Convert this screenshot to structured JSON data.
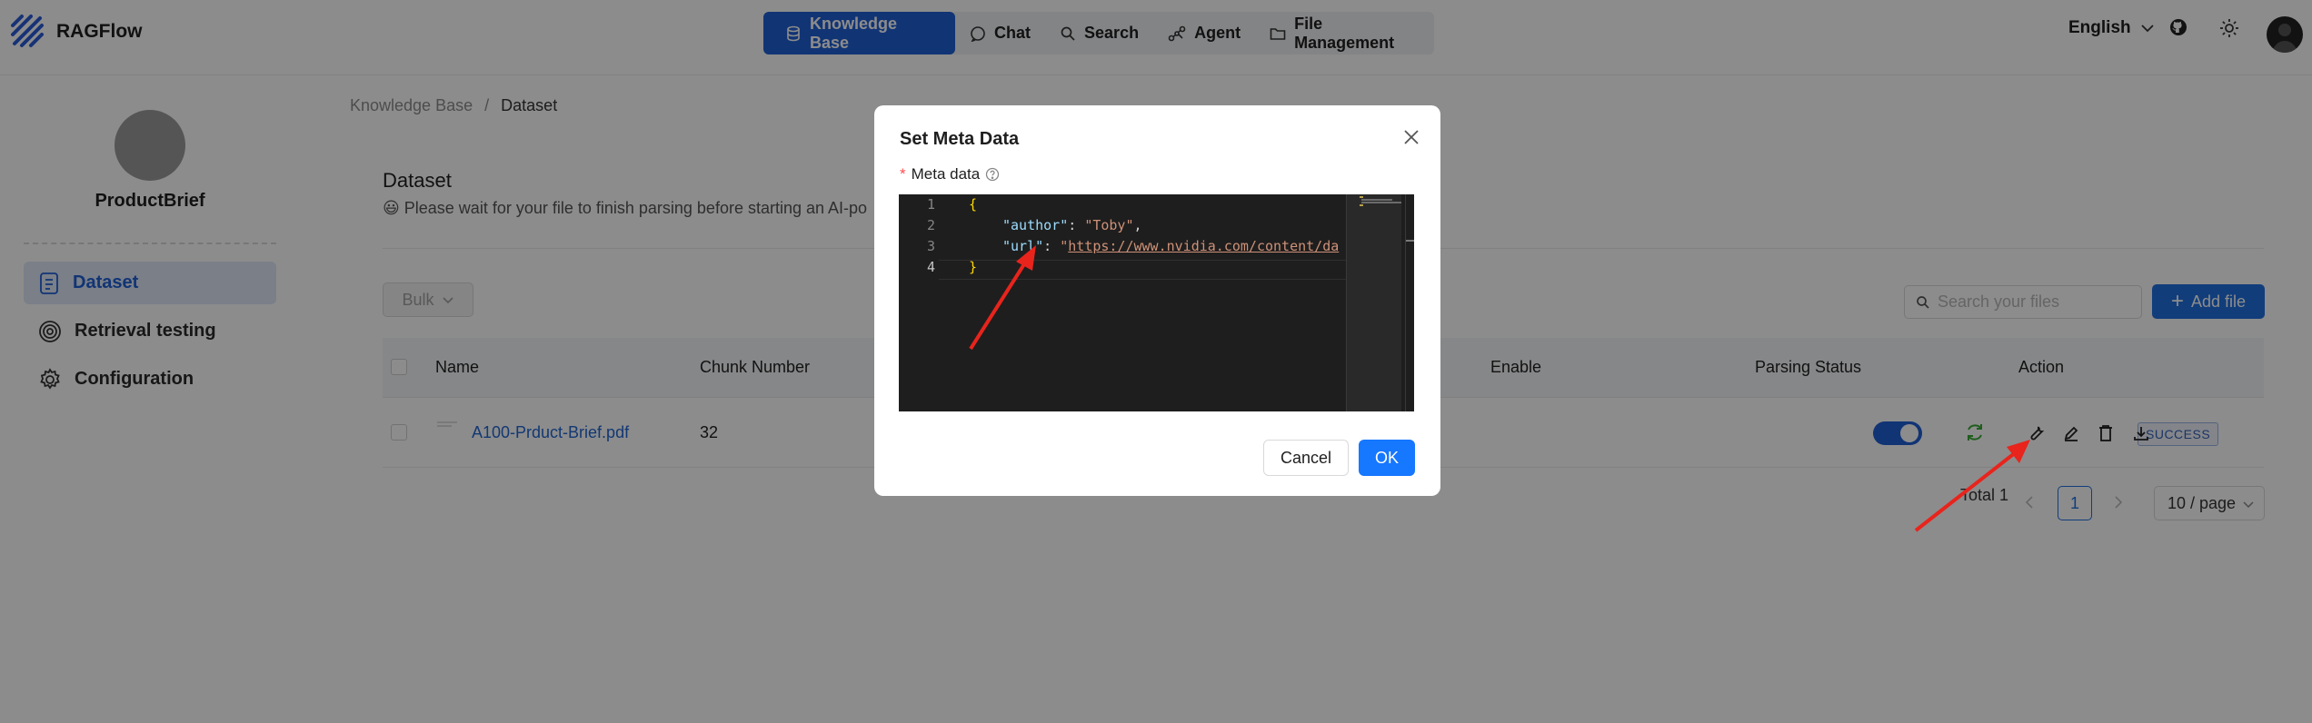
{
  "app": {
    "name": "RAGFlow"
  },
  "nav": {
    "items": [
      {
        "label": "Knowledge Base",
        "icon": "database-icon",
        "active": true
      },
      {
        "label": "Chat",
        "icon": "chat-icon"
      },
      {
        "label": "Search",
        "icon": "search-icon"
      },
      {
        "label": "Agent",
        "icon": "agent-icon"
      },
      {
        "label": "File Management",
        "icon": "folder-icon"
      }
    ]
  },
  "header": {
    "language": "English"
  },
  "sidebar": {
    "kb_name": "ProductBrief",
    "items": [
      {
        "label": "Dataset",
        "icon": "file-icon",
        "active": true
      },
      {
        "label": "Retrieval testing",
        "icon": "target-icon"
      },
      {
        "label": "Configuration",
        "icon": "gear-icon"
      }
    ]
  },
  "breadcrumb": {
    "root": "Knowledge Base",
    "separator": "/",
    "current": "Dataset"
  },
  "dataset": {
    "title": "Dataset",
    "description": "😃 Please wait for your file to finish parsing before starting an AI-po",
    "bulk_label": "Bulk",
    "search_placeholder": "Search your files",
    "add_file_label": "Add file"
  },
  "table": {
    "columns": [
      "Name",
      "Chunk Number",
      "Enable",
      "Parsing Status",
      "Action"
    ],
    "rows": [
      {
        "name": "A100-Prduct-Brief.pdf",
        "chunks": "32",
        "enabled": true,
        "status": "SUCCESS"
      }
    ]
  },
  "pagination": {
    "total_label": "Total 1",
    "current_page": "1",
    "page_size": "10 / page"
  },
  "modal": {
    "title": "Set Meta Data",
    "field_label": "Meta data",
    "editor": {
      "line_numbers": [
        "1",
        "2",
        "3",
        "4"
      ],
      "open_brace": "{",
      "close_brace": "}",
      "author_key": "\"author\"",
      "author_value": "\"Toby\"",
      "url_key": "\"url\"",
      "url_quote": "\"",
      "url_value": "https://www.nvidia.com/content/da"
    },
    "cancel_label": "Cancel",
    "ok_label": "OK"
  },
  "colors": {
    "primary": "#1f5fd6",
    "ok_button": "#1677ff",
    "annotation_arrow": "#e8241c"
  }
}
